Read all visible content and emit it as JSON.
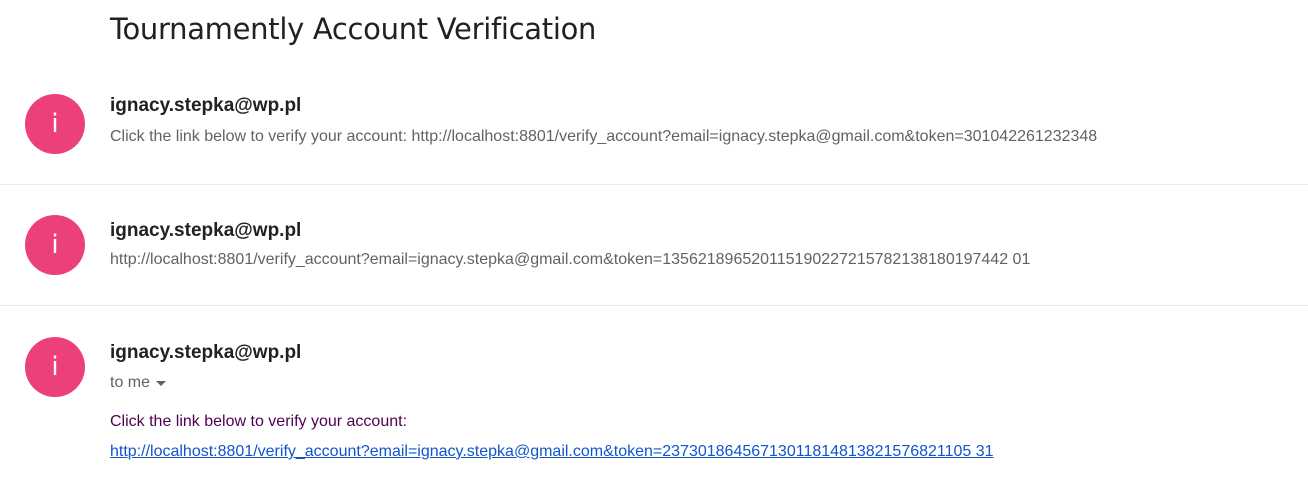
{
  "thread": {
    "subject": "Tournamently Account Verification"
  },
  "messages": [
    {
      "avatar_letter": "i",
      "avatar_color": "#ec407a",
      "sender": "ignacy.stepka@wp.pl",
      "snippet": "Click the link below to verify your account: http://localhost:8801/verify_account?email=ignacy.stepka@gmail.com&token=301042261232348"
    },
    {
      "avatar_letter": "i",
      "avatar_color": "#ec407a",
      "sender": "ignacy.stepka@wp.pl",
      "snippet": "http://localhost:8801/verify_account?email=ignacy.stepka@gmail.com&token=135621896520115190227215782138180197442 01"
    },
    {
      "avatar_letter": "i",
      "avatar_color": "#ec407a",
      "sender": "ignacy.stepka@wp.pl",
      "recipient": "to me",
      "body_text": "Click the link below to verify your account:",
      "body_link": "http://localhost:8801/verify_account?email=ignacy.stepka@gmail.com&token=23730186456713011814813821576821105 31"
    }
  ]
}
